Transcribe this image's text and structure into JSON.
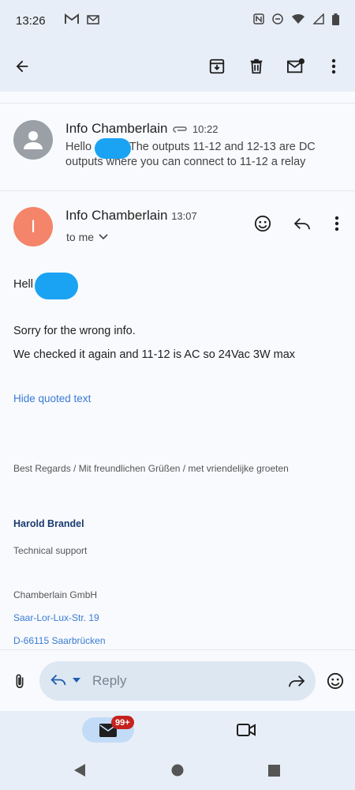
{
  "status_bar": {
    "time": "13:26"
  },
  "collapsed_message": {
    "avatar_initial": "",
    "sender": "Info Chamberlain",
    "time": "10:22",
    "snippet_prefix": "Hello",
    "snippet_rest": "The outputs 11-12 and 12-13 are DC outputs where you can connect to 11-12 a relay"
  },
  "expanded_message": {
    "avatar_initial": "I",
    "sender": "Info Chamberlain",
    "time": "13:07",
    "recipient": "to me",
    "greeting": "Hell",
    "line1": "Sorry for the wrong info.",
    "line2": "We checked it again and 11-12 is AC so 24Vac 3W max",
    "hide_quoted": "Hide quoted text",
    "regards": "Best Regards / Mit freundlichen Grüßen / met vriendelijke groeten",
    "sig_name": "Harold Brandel",
    "sig_role": "Technical support",
    "company": "Chamberlain GmbH",
    "street": "Saar-Lor-Lux-Str. 19",
    "city": "D-66115 Saarbrücken"
  },
  "reply_bar": {
    "placeholder": "Reply"
  },
  "bottom_nav": {
    "mail_badge": "99+"
  },
  "colors": {
    "avatar_expanded": "#f4856a",
    "avatar_collapsed": "#9aa0a6",
    "redaction": "#1aa3f3",
    "badge": "#c5221f"
  }
}
